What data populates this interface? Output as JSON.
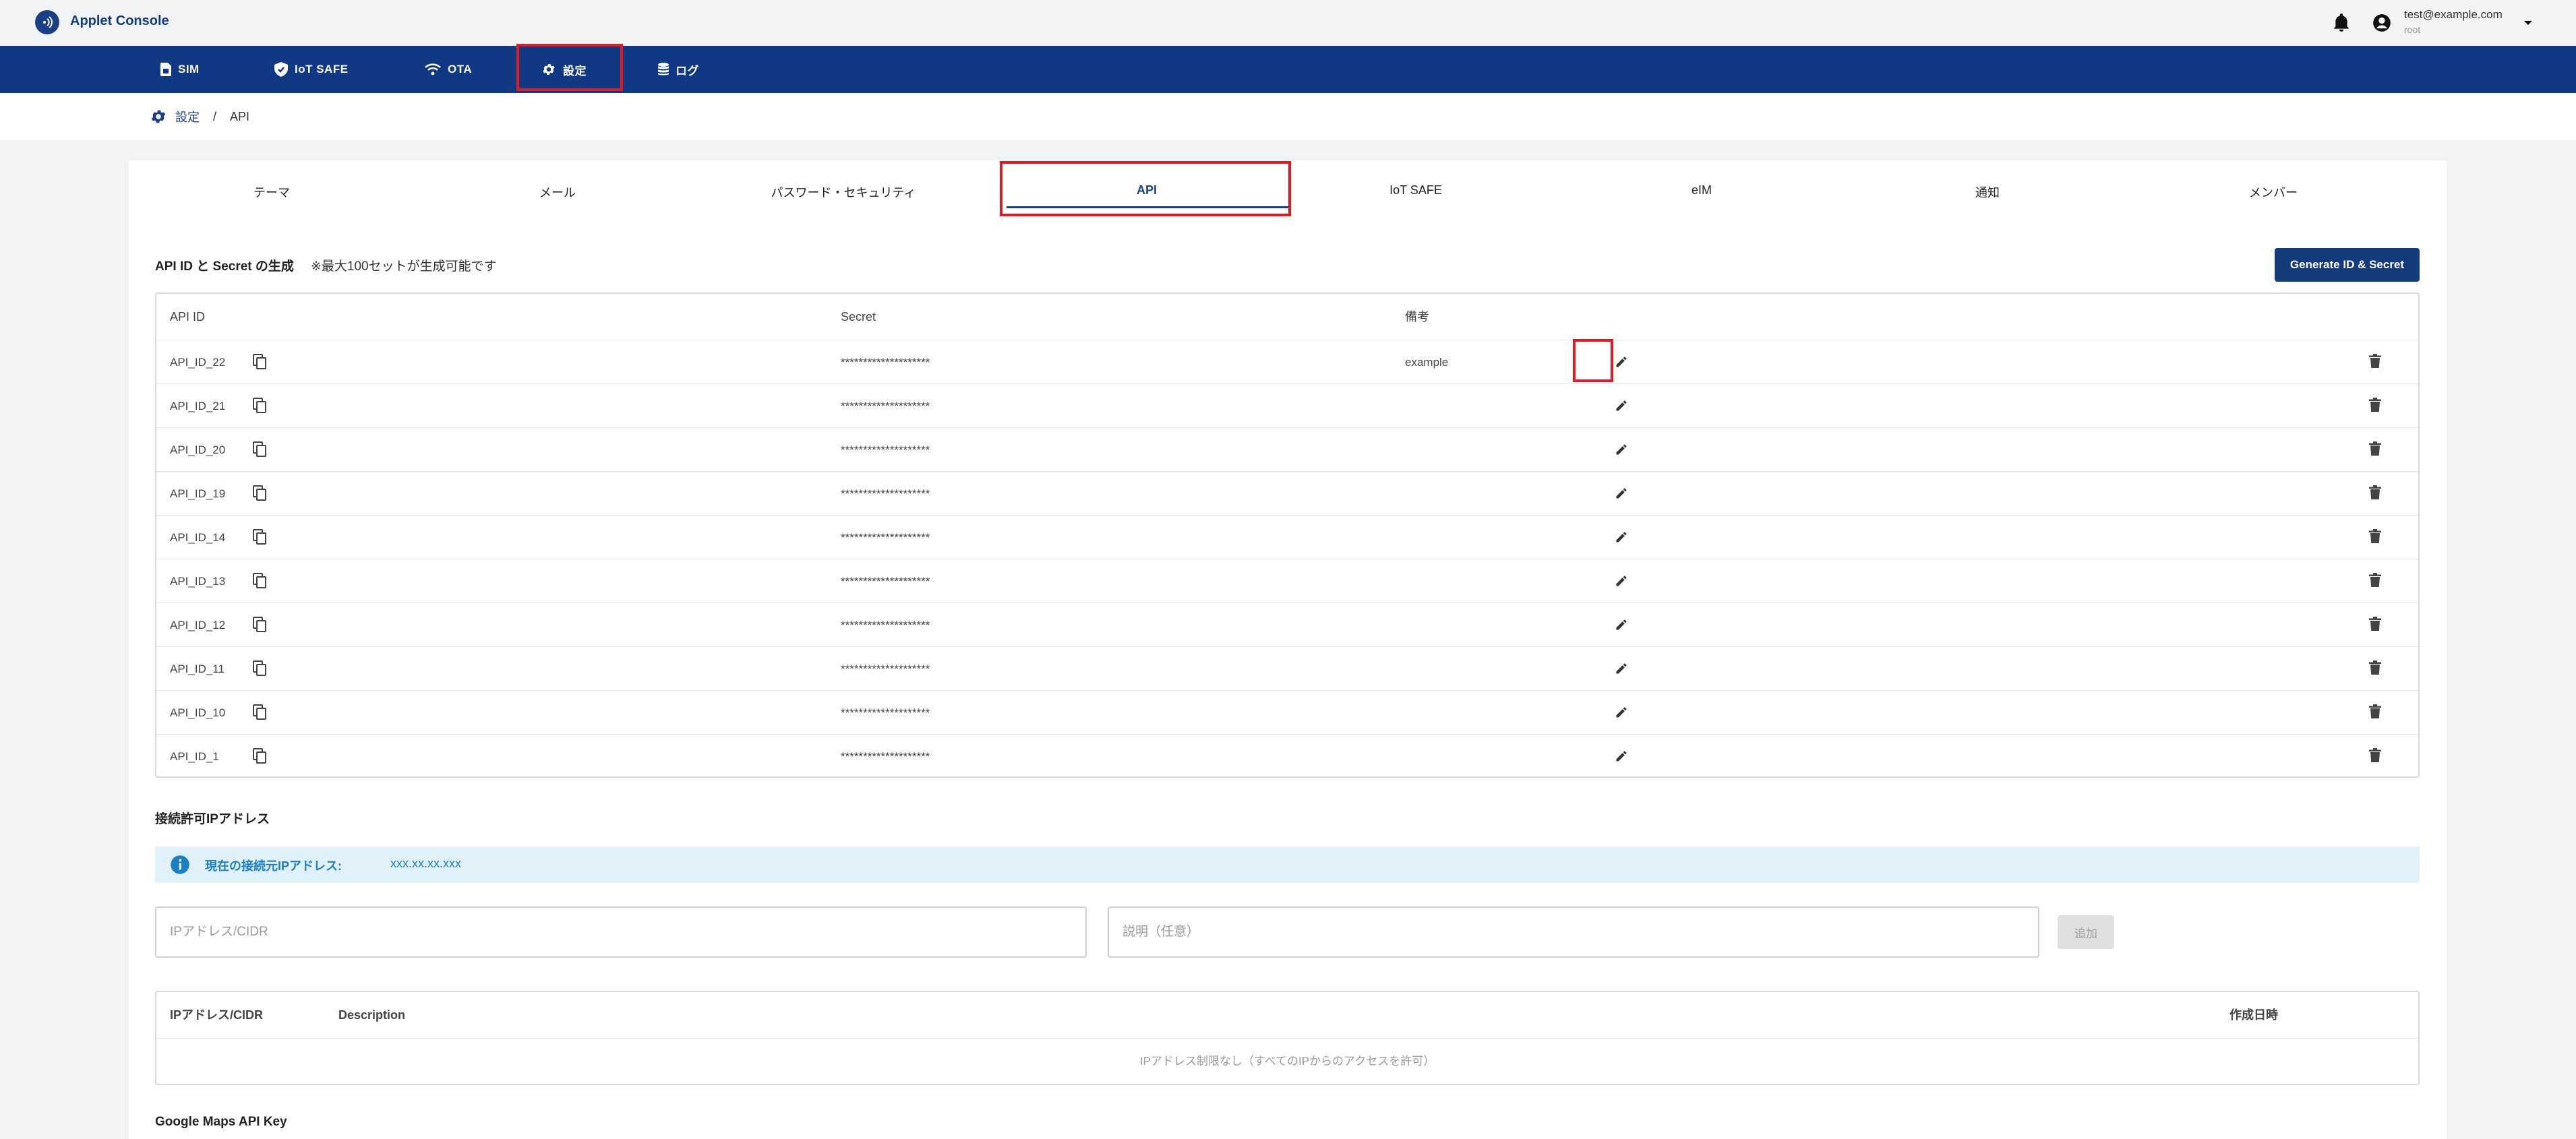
{
  "app": {
    "title": "Applet Console"
  },
  "user": {
    "email": "test@example.com",
    "role": "root"
  },
  "nav": {
    "items": [
      {
        "label": "SIM",
        "icon": "sim-card-icon"
      },
      {
        "label": "IoT SAFE",
        "icon": "shield-icon"
      },
      {
        "label": "OTA",
        "icon": "wifi-icon"
      },
      {
        "label": "設定",
        "icon": "gear-icon"
      },
      {
        "label": "ログ",
        "icon": "database-icon"
      }
    ]
  },
  "breadcrumb": {
    "parent": "設定",
    "separator": "/",
    "current": "API"
  },
  "tabs": [
    "テーマ",
    "メール",
    "パスワード・セキュリティ",
    "API",
    "IoT SAFE",
    "eIM",
    "通知",
    "メンバー"
  ],
  "api_section": {
    "title": "API ID と Secret の生成",
    "note": "※最大100セットが生成可能です",
    "generate_button": "Generate ID & Secret",
    "columns": {
      "id": "API ID",
      "secret": "Secret",
      "note": "備考"
    },
    "rows": [
      {
        "id": "API_ID_22",
        "secret": "********************",
        "note": "example"
      },
      {
        "id": "API_ID_21",
        "secret": "********************",
        "note": ""
      },
      {
        "id": "API_ID_20",
        "secret": "********************",
        "note": ""
      },
      {
        "id": "API_ID_19",
        "secret": "********************",
        "note": ""
      },
      {
        "id": "API_ID_14",
        "secret": "********************",
        "note": ""
      },
      {
        "id": "API_ID_13",
        "secret": "********************",
        "note": ""
      },
      {
        "id": "API_ID_12",
        "secret": "********************",
        "note": ""
      },
      {
        "id": "API_ID_11",
        "secret": "********************",
        "note": ""
      },
      {
        "id": "API_ID_10",
        "secret": "********************",
        "note": ""
      },
      {
        "id": "API_ID_1",
        "secret": "********************",
        "note": ""
      }
    ]
  },
  "ip_section": {
    "title": "接続許可IPアドレス",
    "current_ip_label": "現在の接続元IPアドレス:",
    "current_ip_value": "xxx.xx.xx.xxx",
    "ip_placeholder": "IPアドレス/CIDR",
    "desc_placeholder": "説明（任意）",
    "add_button": "追加",
    "columns": {
      "ip": "IPアドレス/CIDR",
      "description": "Description",
      "created": "作成日時"
    },
    "empty_message": "IPアドレス制限なし（すべてのIPからのアクセスを許可）"
  },
  "maps_section": {
    "title": "Google Maps API Key"
  },
  "colors": {
    "brand": "#103883",
    "highlight": "#e01b24",
    "info_bg": "#e1f1fa",
    "info_text": "#1b7fc3"
  }
}
